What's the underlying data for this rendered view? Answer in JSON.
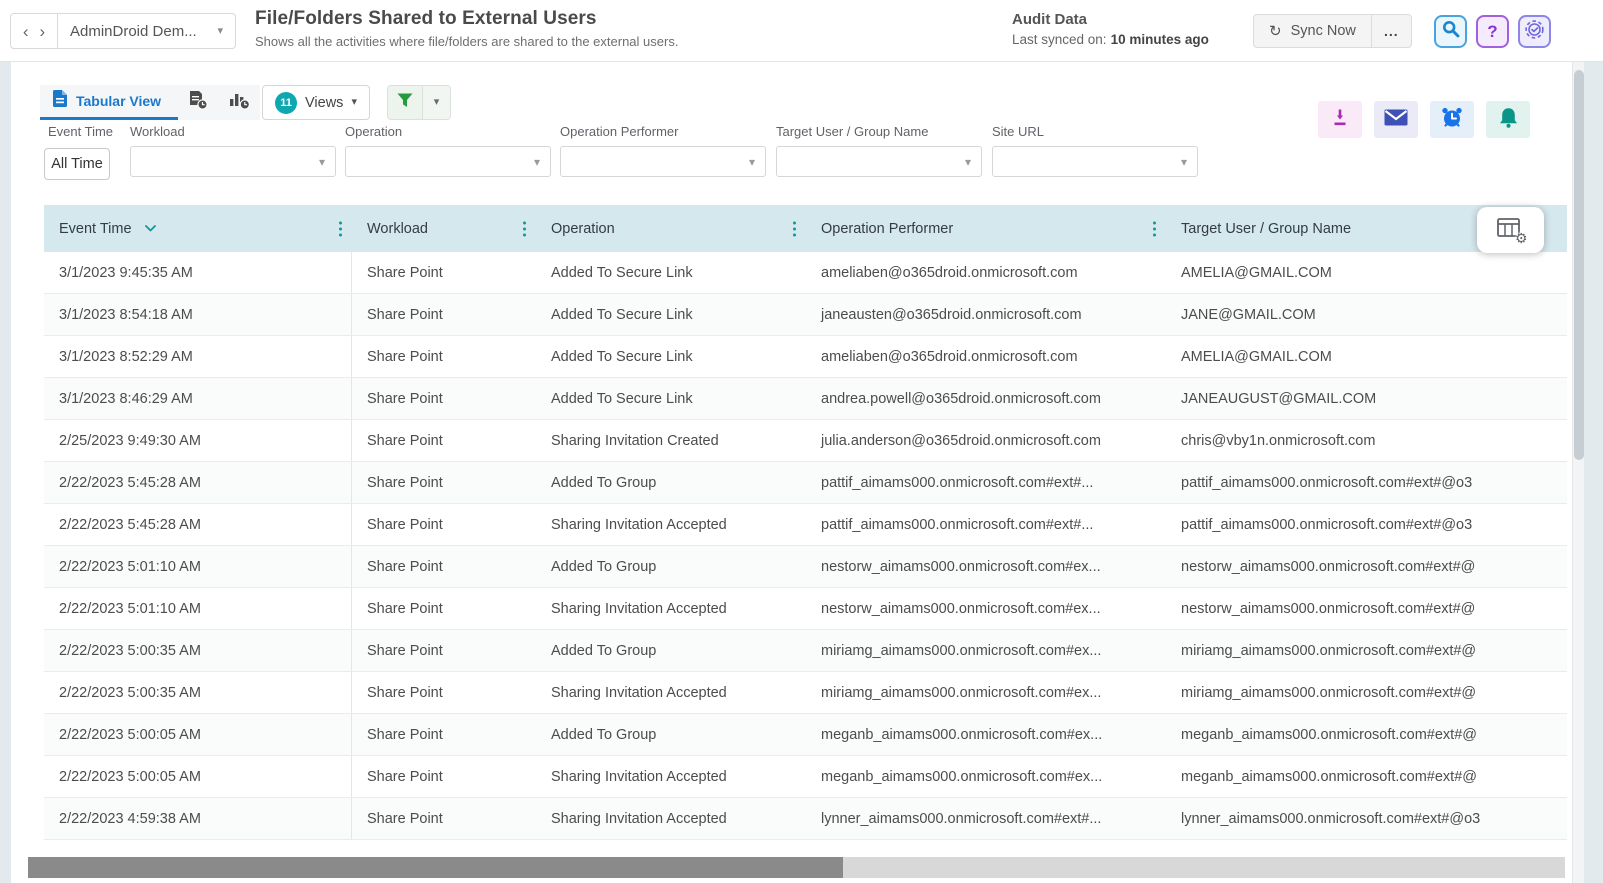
{
  "glyphs": {
    "chevron_left": "‹",
    "chevron_right": "›",
    "caret_down": "▾",
    "sync": "↻",
    "more": "...",
    "help": "?",
    "gear": "⚙"
  },
  "colors": {
    "accent_blue": "#1b79cc",
    "teal_accent": "#0a9a9a",
    "table_header_bg": "#d5e8ee",
    "views_badge_teal": "#10a8b0",
    "filter_green": "#249b3e",
    "search_blue": "#1887d0",
    "help_purple": "#8c33d6",
    "tasks_violet": "#6f66dd",
    "download_magenta": "#a82bb5",
    "mail_indigo": "#3f51b5",
    "alarm_blue": "#1a73e8",
    "bell_teal": "#0b9488"
  },
  "top_bar": {
    "tenant_selector": "AdminDroid Dem...",
    "title": "File/Folders Shared to External Users",
    "subtitle": "Shows all the activities where file/folders are shared to the external users.",
    "audit_label": "Audit Data",
    "last_synced_label": "Last synced on:",
    "last_synced_value": "10 minutes ago",
    "sync_button_label": "Sync Now"
  },
  "toolbar": {
    "tab_label": "Tabular View",
    "views_count": "11",
    "views_label": "Views"
  },
  "filters": {
    "event_time_label": "Event Time",
    "event_time_value": "All Time",
    "dropdowns": [
      {
        "label": "Workload",
        "value": ""
      },
      {
        "label": "Operation",
        "value": ""
      },
      {
        "label": "Operation Performer",
        "value": ""
      },
      {
        "label": "Target User / Group Name",
        "value": ""
      },
      {
        "label": "Site URL",
        "value": ""
      }
    ]
  },
  "table": {
    "columns": [
      "Event Time",
      "Workload",
      "Operation",
      "Operation Performer",
      "Target User / Group Name"
    ],
    "sorted_column": "Event Time",
    "sort_direction": "desc",
    "rows": [
      {
        "time": "3/1/2023 9:45:35 AM",
        "workload": "Share Point",
        "operation": "Added To Secure Link",
        "performer": "ameliaben@o365droid.onmicrosoft.com",
        "target": "AMELIA@GMAIL.COM"
      },
      {
        "time": "3/1/2023 8:54:18 AM",
        "workload": "Share Point",
        "operation": "Added To Secure Link",
        "performer": "janeausten@o365droid.onmicrosoft.com",
        "target": "JANE@GMAIL.COM"
      },
      {
        "time": "3/1/2023 8:52:29 AM",
        "workload": "Share Point",
        "operation": "Added To Secure Link",
        "performer": "ameliaben@o365droid.onmicrosoft.com",
        "target": "AMELIA@GMAIL.COM"
      },
      {
        "time": "3/1/2023 8:46:29 AM",
        "workload": "Share Point",
        "operation": "Added To Secure Link",
        "performer": "andrea.powell@o365droid.onmicrosoft.com",
        "target": "JANEAUGUST@GMAIL.COM"
      },
      {
        "time": "2/25/2023 9:49:30 AM",
        "workload": "Share Point",
        "operation": "Sharing Invitation Created",
        "performer": "julia.anderson@o365droid.onmicrosoft.com",
        "target": "chris@vby1n.onmicrosoft.com"
      },
      {
        "time": "2/22/2023 5:45:28 AM",
        "workload": "Share Point",
        "operation": "Added To Group",
        "performer": "pattif_aimams000.onmicrosoft.com#ext#...",
        "target": "pattif_aimams000.onmicrosoft.com#ext#@o3"
      },
      {
        "time": "2/22/2023 5:45:28 AM",
        "workload": "Share Point",
        "operation": "Sharing Invitation Accepted",
        "performer": "pattif_aimams000.onmicrosoft.com#ext#...",
        "target": "pattif_aimams000.onmicrosoft.com#ext#@o3"
      },
      {
        "time": "2/22/2023 5:01:10 AM",
        "workload": "Share Point",
        "operation": "Added To Group",
        "performer": "nestorw_aimams000.onmicrosoft.com#ex...",
        "target": "nestorw_aimams000.onmicrosoft.com#ext#@"
      },
      {
        "time": "2/22/2023 5:01:10 AM",
        "workload": "Share Point",
        "operation": "Sharing Invitation Accepted",
        "performer": "nestorw_aimams000.onmicrosoft.com#ex...",
        "target": "nestorw_aimams000.onmicrosoft.com#ext#@"
      },
      {
        "time": "2/22/2023 5:00:35 AM",
        "workload": "Share Point",
        "operation": "Added To Group",
        "performer": "miriamg_aimams000.onmicrosoft.com#ex...",
        "target": "miriamg_aimams000.onmicrosoft.com#ext#@"
      },
      {
        "time": "2/22/2023 5:00:35 AM",
        "workload": "Share Point",
        "operation": "Sharing Invitation Accepted",
        "performer": "miriamg_aimams000.onmicrosoft.com#ex...",
        "target": "miriamg_aimams000.onmicrosoft.com#ext#@"
      },
      {
        "time": "2/22/2023 5:00:05 AM",
        "workload": "Share Point",
        "operation": "Added To Group",
        "performer": "meganb_aimams000.onmicrosoft.com#ex...",
        "target": "meganb_aimams000.onmicrosoft.com#ext#@"
      },
      {
        "time": "2/22/2023 5:00:05 AM",
        "workload": "Share Point",
        "operation": "Sharing Invitation Accepted",
        "performer": "meganb_aimams000.onmicrosoft.com#ex...",
        "target": "meganb_aimams000.onmicrosoft.com#ext#@"
      },
      {
        "time": "2/22/2023 4:59:38 AM",
        "workload": "Share Point",
        "operation": "Sharing Invitation Accepted",
        "performer": "lynner_aimams000.onmicrosoft.com#ext#...",
        "target": "lynner_aimams000.onmicrosoft.com#ext#@o3"
      }
    ]
  }
}
